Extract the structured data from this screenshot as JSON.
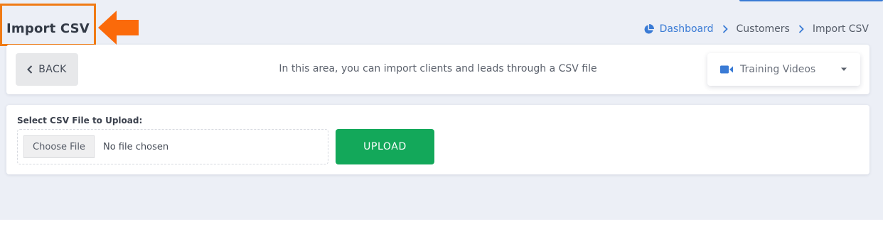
{
  "header": {
    "title": "Import CSV"
  },
  "breadcrumb": {
    "items": [
      "Dashboard",
      "Customers",
      "Import CSV"
    ]
  },
  "toolbar": {
    "back_label": "BACK",
    "info_text": "In this area, you can import clients and leads through a CSV file",
    "training_label": "Training Videos"
  },
  "upload": {
    "label": "Select CSV File to Upload:",
    "choose_label": "Choose File",
    "file_status": "No file chosen",
    "upload_label": "UPLOAD"
  },
  "colors": {
    "annotation_orange": "#f07a14",
    "link_blue": "#3a7bd5",
    "upload_green": "#13a85a",
    "page_background": "#eceff6"
  },
  "icons": {
    "dashboard": "pie-chart-icon",
    "breadcrumb_separator": "chevron-right-icon",
    "back": "chevron-left-icon",
    "training": "video-camera-icon",
    "dropdown": "caret-down-icon",
    "annotation": "arrow-left-icon"
  }
}
